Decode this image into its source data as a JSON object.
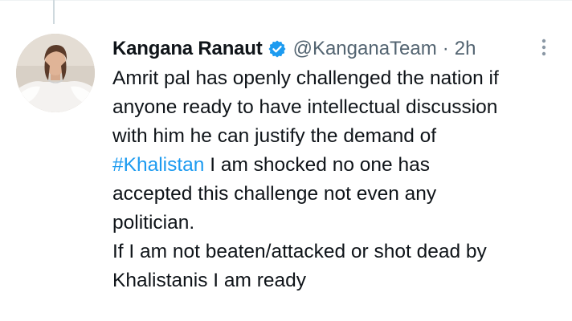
{
  "tweet": {
    "author_name": "Kangana Ranaut",
    "handle": "@KanganaTeam",
    "separator": "·",
    "timestamp": "2h",
    "verified": true,
    "hashtag": "#Khalistan",
    "lines": [
      "Amrit pal has openly challenged the nation if",
      "anyone ready to have intellectual discussion",
      "with him he can justify the demand of",
      " I am shocked no one has",
      "accepted this challenge not even any",
      "politician.",
      "If I am not beaten/attacked or shot dead by",
      "Khalistanis I am ready"
    ]
  },
  "icons": {
    "verified": "verified-badge-icon",
    "more": "more-options-icon"
  },
  "colors": {
    "text": "#0f1419",
    "secondary": "#536471",
    "link": "#1d9bf0",
    "verified": "#1d9bf0",
    "thread_line": "#cfd9de"
  }
}
